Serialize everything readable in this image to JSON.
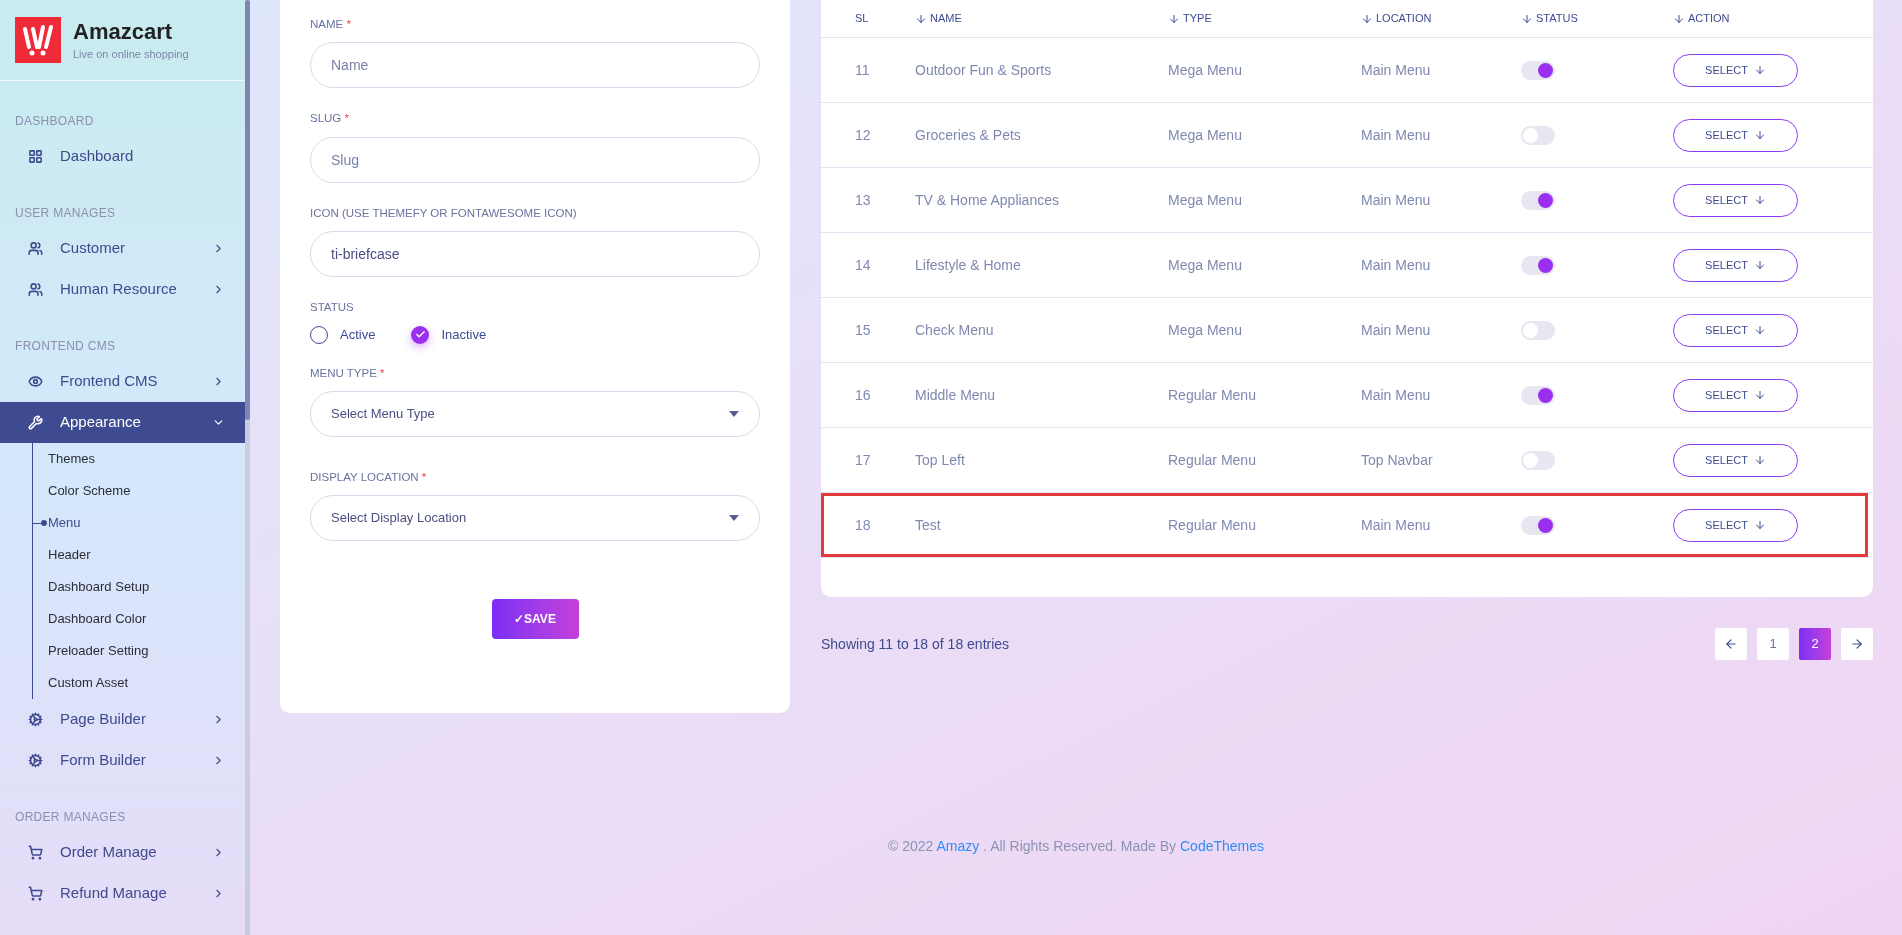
{
  "brand": {
    "title": "Amazcart",
    "tagline": "Live on online shopping"
  },
  "sidebar": {
    "sections": [
      {
        "title": "DASHBOARD",
        "items": [
          {
            "label": "Dashboard",
            "active": false
          }
        ]
      },
      {
        "title": "USER MANAGES",
        "items": [
          {
            "label": "Customer",
            "active": false,
            "expanded": false
          },
          {
            "label": "Human Resource",
            "active": false,
            "expanded": false
          }
        ]
      },
      {
        "title": "FRONTEND CMS",
        "items": [
          {
            "label": "Frontend CMS",
            "active": false,
            "expanded": false
          },
          {
            "label": "Appearance",
            "active": true,
            "expanded": true,
            "children": [
              {
                "label": "Themes",
                "selected": false
              },
              {
                "label": "Color Scheme",
                "selected": false
              },
              {
                "label": "Menu",
                "selected": true
              },
              {
                "label": "Header",
                "selected": false
              },
              {
                "label": "Dashboard Setup",
                "selected": false
              },
              {
                "label": "Dashboard Color",
                "selected": false
              },
              {
                "label": "Preloader Setting",
                "selected": false
              },
              {
                "label": "Custom Asset",
                "selected": false
              }
            ]
          },
          {
            "label": "Page Builder",
            "active": false,
            "expanded": false
          },
          {
            "label": "Form Builder",
            "active": false,
            "expanded": false
          }
        ]
      },
      {
        "title": "ORDER MANAGES",
        "items": [
          {
            "label": "Order Manage",
            "active": false,
            "expanded": false
          },
          {
            "label": "Refund Manage",
            "active": false,
            "expanded": false
          }
        ]
      }
    ]
  },
  "form": {
    "fields": [
      {
        "kind": "text",
        "label": "NAME",
        "required_mark": "*",
        "placeholder": "Name"
      },
      {
        "kind": "text",
        "label": "SLUG",
        "required_mark": "*",
        "placeholder": "Slug"
      },
      {
        "kind": "text",
        "label": "ICON (USE THEMEFY OR FONTAWESOME ICON)",
        "value": "ti-briefcase"
      },
      {
        "kind": "radio",
        "label": "STATUS",
        "options": [
          {
            "label": "Active",
            "selected": false
          },
          {
            "label": "Inactive",
            "selected": true
          }
        ]
      },
      {
        "kind": "select",
        "label": "MENU TYPE",
        "required_mark": "*",
        "placeholder": "Select Menu Type"
      },
      {
        "kind": "select",
        "label": "DISPLAY LOCATION",
        "required_mark": "*",
        "placeholder": "Select Display Location"
      }
    ],
    "save_button": "✓SAVE"
  },
  "table": {
    "columns": [
      {
        "label": "SL",
        "sortable": false
      },
      {
        "label": "NAME",
        "sortable": true
      },
      {
        "label": "TYPE",
        "sortable": true
      },
      {
        "label": "LOCATION",
        "sortable": true
      },
      {
        "label": "STATUS",
        "sortable": true
      },
      {
        "label": "ACTION",
        "sortable": true
      }
    ],
    "rows": [
      {
        "sl": "11",
        "name": "Outdoor Fun & Sports",
        "type": "Mega Menu",
        "location": "Main Menu",
        "on": true,
        "action": "SELECT",
        "highlighted": false
      },
      {
        "sl": "12",
        "name": "Groceries & Pets",
        "type": "Mega Menu",
        "location": "Main Menu",
        "on": false,
        "action": "SELECT",
        "highlighted": false
      },
      {
        "sl": "13",
        "name": "TV & Home Appliances",
        "type": "Mega Menu",
        "location": "Main Menu",
        "on": true,
        "action": "SELECT",
        "highlighted": false
      },
      {
        "sl": "14",
        "name": "Lifestyle & Home",
        "type": "Mega Menu",
        "location": "Main Menu",
        "on": true,
        "action": "SELECT",
        "highlighted": false
      },
      {
        "sl": "15",
        "name": "Check Menu",
        "type": "Mega Menu",
        "location": "Main Menu",
        "on": false,
        "action": "SELECT",
        "highlighted": false
      },
      {
        "sl": "16",
        "name": "Middle Menu",
        "type": "Regular Menu",
        "location": "Main Menu",
        "on": true,
        "action": "SELECT",
        "highlighted": false
      },
      {
        "sl": "17",
        "name": "Top Left",
        "type": "Regular Menu",
        "location": "Top Navbar",
        "on": false,
        "action": "SELECT",
        "highlighted": false
      },
      {
        "sl": "18",
        "name": "Test",
        "type": "Regular Menu",
        "location": "Main Menu",
        "on": true,
        "action": "SELECT",
        "highlighted": true
      }
    ]
  },
  "pagination": {
    "summary": "Showing 11 to 18 of 18 entries",
    "pages": [
      {
        "label": "1",
        "selected": false
      },
      {
        "label": "2",
        "selected": true
      }
    ]
  },
  "footer": {
    "prefix": "© 2022",
    "brand_link": "Amazy",
    "middle": ". All Rights Reserved. Made By",
    "author_link": "CodeThemes"
  }
}
